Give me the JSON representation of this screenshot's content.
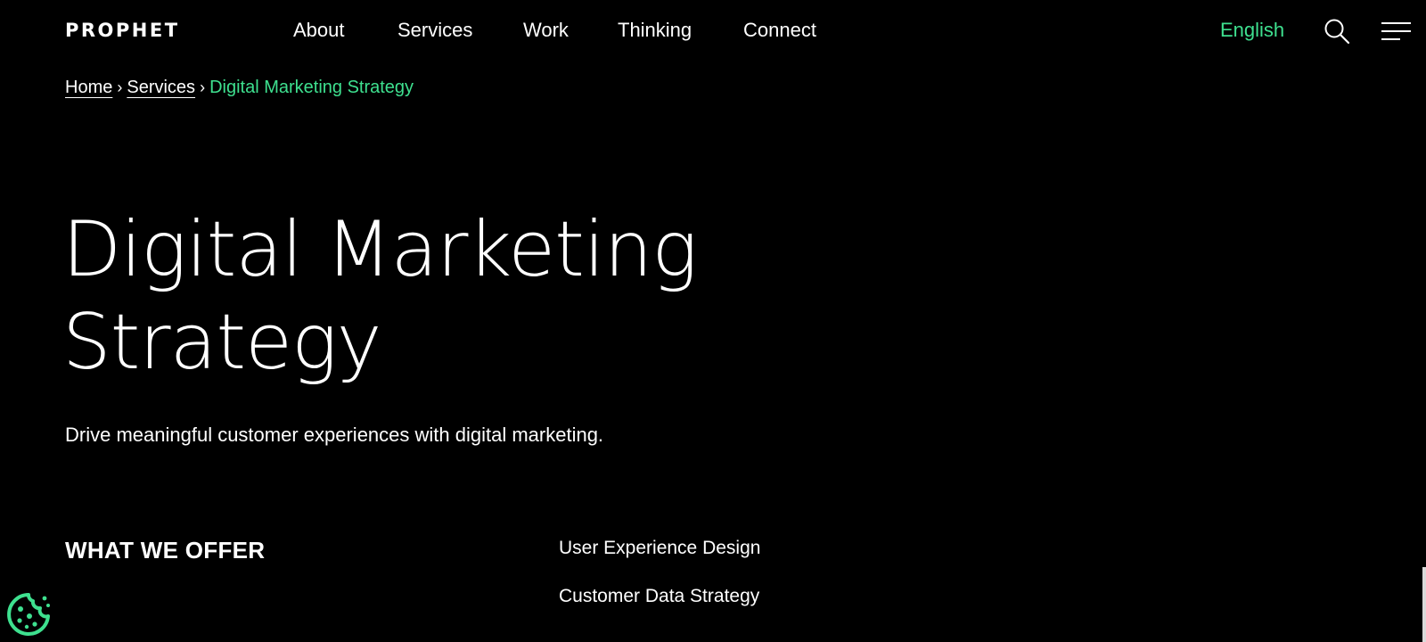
{
  "header": {
    "logo": "PROPHET",
    "nav": [
      {
        "label": "About"
      },
      {
        "label": "Services"
      },
      {
        "label": "Work"
      },
      {
        "label": "Thinking"
      },
      {
        "label": "Connect"
      }
    ],
    "language": "English",
    "search_icon": "search-icon",
    "menu_icon": "hamburger-menu-icon"
  },
  "breadcrumb": {
    "home": "Home",
    "separator": "›",
    "services": "Services",
    "current": "Digital Marketing Strategy"
  },
  "hero": {
    "title_line1": "Digital Marketing",
    "title_line2": "Strategy",
    "subtitle": "Drive meaningful customer experiences with digital marketing."
  },
  "offer": {
    "heading": "WHAT WE OFFER",
    "items": [
      "User Experience Design",
      "Customer Data Strategy"
    ]
  },
  "cookie": {
    "icon": "cookie-icon"
  },
  "colors": {
    "accent": "#3ee08f",
    "background": "#000000",
    "text": "#ffffff"
  }
}
